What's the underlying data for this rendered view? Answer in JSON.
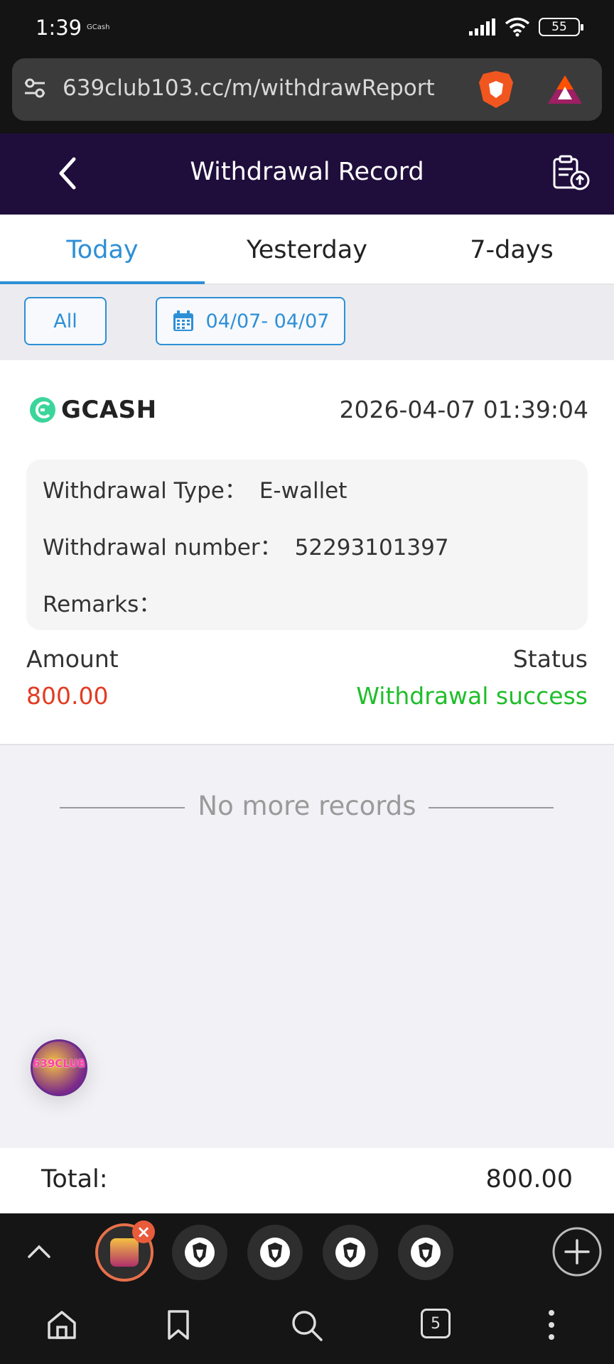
{
  "status_bar": {
    "time": "1:39",
    "notification": "GCash",
    "battery": "55"
  },
  "browser": {
    "url": "639club103.cc/m/withdrawReport",
    "tab_count": "5"
  },
  "header": {
    "title": "Withdrawal Record"
  },
  "tabs": [
    {
      "label": "Today",
      "active": true
    },
    {
      "label": "Yesterday",
      "active": false
    },
    {
      "label": "7-days",
      "active": false
    }
  ],
  "filters": {
    "all_label": "All",
    "date_range": "04/07- 04/07"
  },
  "record": {
    "provider": "GCASH",
    "datetime": "2026-04-07 01:39:04",
    "type_label": "Withdrawal Type：",
    "type_value": "E-wallet",
    "number_label": "Withdrawal number：",
    "number_value": "52293101397",
    "remarks_label": "Remarks：",
    "remarks_value": "",
    "amount_label": "Amount",
    "amount_value": "800.00",
    "status_label": "Status",
    "status_value": "Withdrawal success"
  },
  "no_more": "No more records",
  "float_button": {
    "label": "639CLUB"
  },
  "total": {
    "label": "Total:",
    "value": "800.00"
  },
  "colors": {
    "accent": "#2d8fd6",
    "header_bg": "#1f0e3c",
    "amount": "#e23c22",
    "success": "#1fbe2a"
  }
}
